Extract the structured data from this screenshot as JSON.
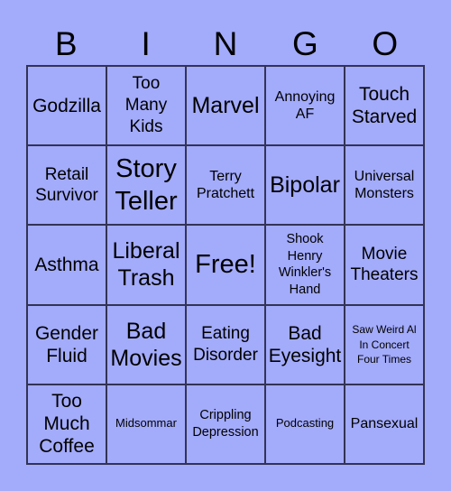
{
  "header": {
    "letters": [
      "B",
      "I",
      "N",
      "G",
      "O"
    ]
  },
  "colors": {
    "background": "#A3ABFB",
    "border": "#333355",
    "text": "#000000"
  },
  "card": {
    "rows": [
      [
        {
          "text": "Godzilla",
          "size": "s-m"
        },
        {
          "text": "Too Many Kids",
          "size": "s-ms"
        },
        {
          "text": "Marvel",
          "size": "s-l"
        },
        {
          "text": "Annoying AF",
          "size": "s-s"
        },
        {
          "text": "Touch Starved",
          "size": "s-m"
        }
      ],
      [
        {
          "text": "Retail Survivor",
          "size": "s-ms"
        },
        {
          "text": "Story Teller",
          "size": "s-xl"
        },
        {
          "text": "Terry Pratchett",
          "size": "s-s"
        },
        {
          "text": "Bipolar",
          "size": "s-l"
        },
        {
          "text": "Universal Monsters",
          "size": "s-s"
        }
      ],
      [
        {
          "text": "Asthma",
          "size": "s-m"
        },
        {
          "text": "Liberal Trash",
          "size": "s-l"
        },
        {
          "text": "Free!",
          "size": "s-xl",
          "free": true
        },
        {
          "text": "Shook Henry Winkler's Hand",
          "size": "s-xs"
        },
        {
          "text": "Movie Theaters",
          "size": "s-ms"
        }
      ],
      [
        {
          "text": "Gender Fluid",
          "size": "s-m"
        },
        {
          "text": "Bad Movies",
          "size": "s-l"
        },
        {
          "text": "Eating Disorder",
          "size": "s-ms"
        },
        {
          "text": "Bad Eyesight",
          "size": "s-m"
        },
        {
          "text": "Saw Weird Al In Concert Four Times",
          "size": "s-tiny"
        }
      ],
      [
        {
          "text": "Too Much Coffee",
          "size": "s-m"
        },
        {
          "text": "Midsommar",
          "size": "s-xxs"
        },
        {
          "text": "Crippling Depression",
          "size": "s-xs"
        },
        {
          "text": "Podcasting",
          "size": "s-xxs"
        },
        {
          "text": "Pansexual",
          "size": "s-s"
        }
      ]
    ]
  }
}
